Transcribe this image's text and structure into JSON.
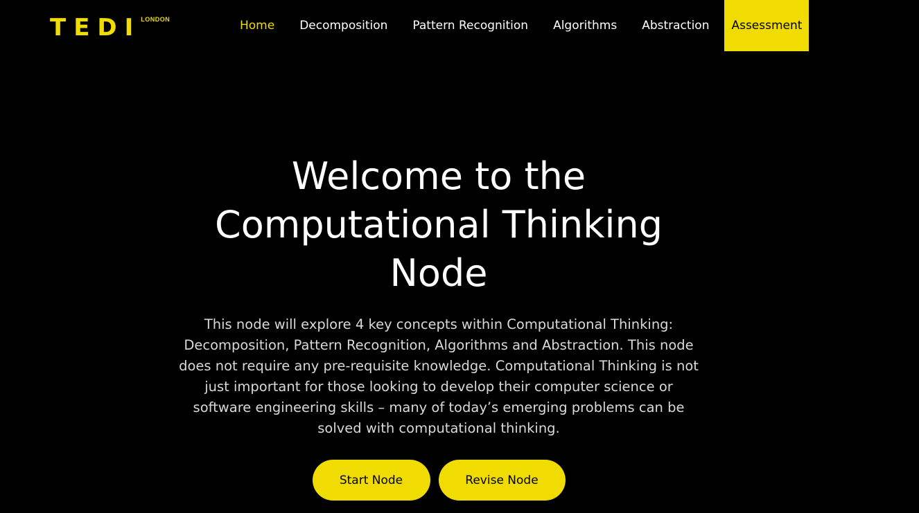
{
  "brand": {
    "logo_text": "TEDI",
    "logo_sub": "LONDON",
    "accent_color": "#f0dc00"
  },
  "nav": {
    "items": [
      {
        "label": "Home",
        "state": "active"
      },
      {
        "label": "Decomposition",
        "state": "normal"
      },
      {
        "label": "Pattern Recognition",
        "state": "normal"
      },
      {
        "label": "Algorithms",
        "state": "normal"
      },
      {
        "label": "Abstraction",
        "state": "normal"
      },
      {
        "label": "Assessment",
        "state": "highlighted"
      }
    ]
  },
  "hero": {
    "title": "Welcome to the Computational Thinking Node",
    "description": "This node will explore 4 key concepts within Computational Thinking: Decomposition, Pattern Recognition, Algorithms and Abstraction. This node does not require any pre-requisite knowledge. Computational Thinking is not just important for those looking to develop their computer science or software engineering skills – many of today’s emerging problems can be solved with computational thinking.",
    "start_button": "Start Node",
    "revise_button": "Revise Node"
  }
}
